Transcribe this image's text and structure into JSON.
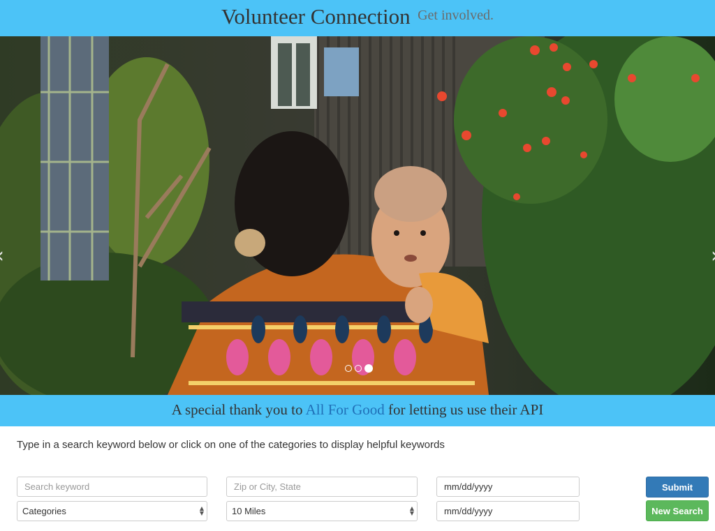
{
  "header": {
    "title": "Volunteer Connection",
    "tagline": "Get involved."
  },
  "carousel": {
    "prev_icon": "chevron-left-icon",
    "next_icon": "chevron-right-icon",
    "prev_glyph": "‹",
    "next_glyph": "›",
    "slides_count": 3,
    "active_slide": 3
  },
  "thanks": {
    "before": "A special thank you to ",
    "link": "All For Good",
    "after": " for letting us use their API"
  },
  "instructions": "Type in a search keyword below or click on one of the categories to display helpful keywords",
  "form": {
    "keyword_placeholder": "Search keyword",
    "location_placeholder": "Zip or City, State",
    "start_date_placeholder": "mm/dd/yyyy",
    "end_date_placeholder": "mm/dd/yyyy",
    "category_selected": "Categories",
    "distance_selected": "10 Miles",
    "submit_label": "Submit",
    "new_search_label": "New Search"
  },
  "colors": {
    "banner": "#4cc3f7",
    "link": "#2070b8",
    "submit": "#337ab7",
    "new_search": "#5cb85c"
  }
}
